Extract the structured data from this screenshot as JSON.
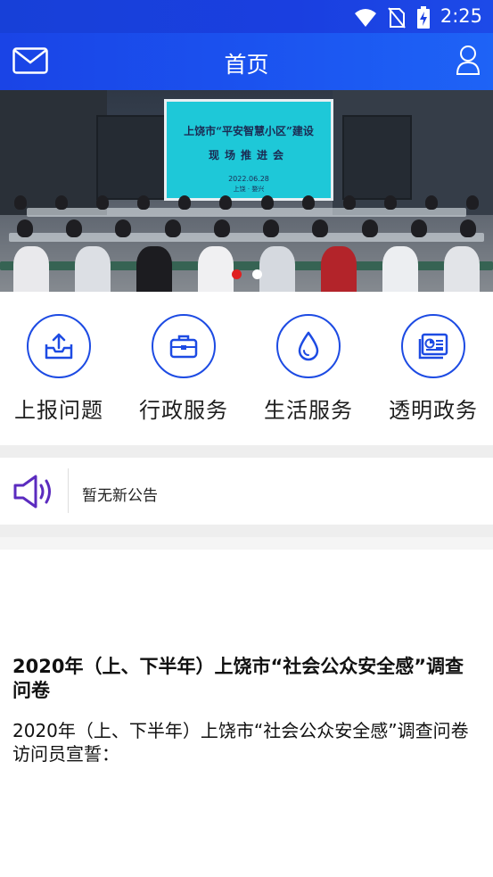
{
  "status_bar": {
    "time": "2:25"
  },
  "header": {
    "title": "首页",
    "mail_icon": "mail-icon",
    "user_icon": "user-icon"
  },
  "banner": {
    "screen_line1": "上饶市“平安智慧小区”建设",
    "screen_line2": "现场推进会",
    "screen_date": "2022.06.28",
    "screen_place": "上饶 · 婺兴",
    "slide_count": 2,
    "active_slide": 1
  },
  "services": [
    {
      "label": "上报问题",
      "icon": "upload-tray-icon"
    },
    {
      "label": "行政服务",
      "icon": "briefcase-icon"
    },
    {
      "label": "生活服务",
      "icon": "water-drop-icon"
    },
    {
      "label": "透明政务",
      "icon": "document-chart-icon"
    }
  ],
  "notice": {
    "text": "暂无新公告",
    "icon": "speaker-icon"
  },
  "article": {
    "title": "2020年（上、下半年）上饶市“社会公众安全感”调查问卷",
    "body_line1": "2020年（上、下半年）上饶市“社会公众安全感”调查问卷",
    "body_line2": "访问员宣誓："
  },
  "colors": {
    "primary": "#1d4be3",
    "notice_icon": "#5b2bbf",
    "active_dot": "#e02020"
  }
}
